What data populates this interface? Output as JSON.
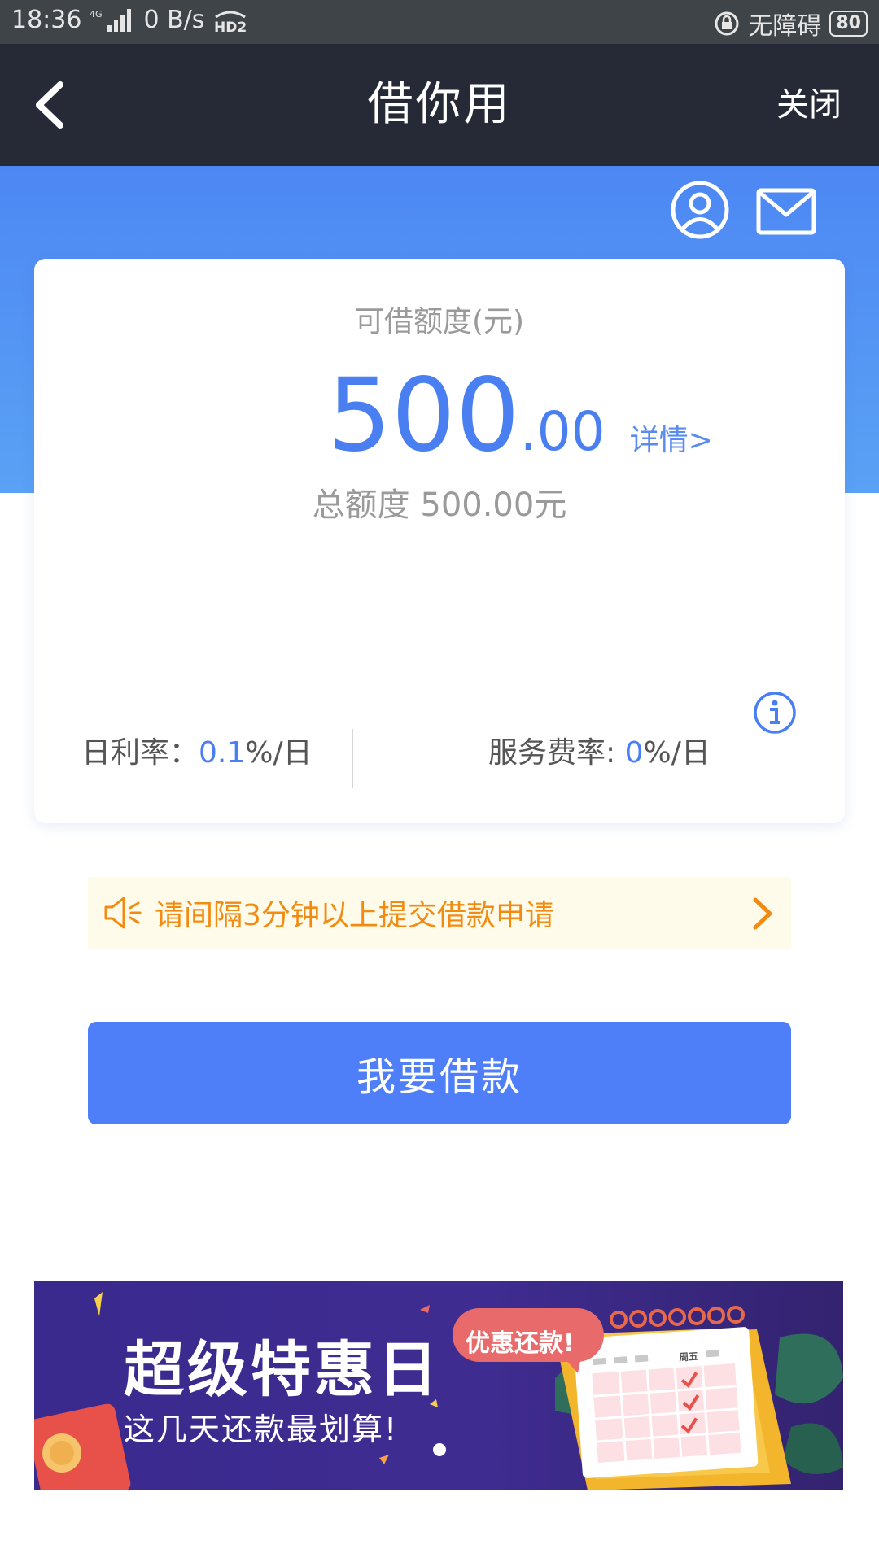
{
  "status_bar": {
    "time": "18:36",
    "network": "4G",
    "speed": "0 B/s",
    "hd": "HD2",
    "accessibility": "无障碍",
    "battery": "80"
  },
  "nav": {
    "title": "借你用",
    "close_label": "关闭"
  },
  "card": {
    "label": "可借额度(元)",
    "amount_int": "500",
    "amount_dec": ".00",
    "detail_link": "详情>",
    "total_label": "总额度 500.00元",
    "daily_rate_label": "日利率：",
    "daily_rate_value": "0.1",
    "daily_rate_unit": "%/日",
    "service_rate_label": "服务费率: ",
    "service_rate_value": "0",
    "service_rate_unit": "%/日"
  },
  "notice": {
    "text": "请间隔3分钟以上提交借款申请"
  },
  "borrow_button": {
    "label": "我要借款"
  },
  "banner": {
    "title": "超级特惠日",
    "subtitle": "这几天还款最划算!",
    "bubble_text": "优惠还款!",
    "calendar_day": "周五"
  },
  "colors": {
    "nav_bg": "#262a37",
    "hero_blue": "#4d87f3",
    "accent_blue": "#4a7ff1",
    "button_blue": "#4e7ef8",
    "notice_orange": "#f28b12",
    "banner_purple": "#3f2c91"
  },
  "icons": {
    "back": "chevron-left-icon",
    "user": "user-circle-icon",
    "mail": "mail-icon",
    "info": "info-icon",
    "speaker": "speaker-icon",
    "notice_arrow": "chevron-right-icon"
  },
  "carousel": {
    "current_page": 1,
    "total_pages": 1
  }
}
